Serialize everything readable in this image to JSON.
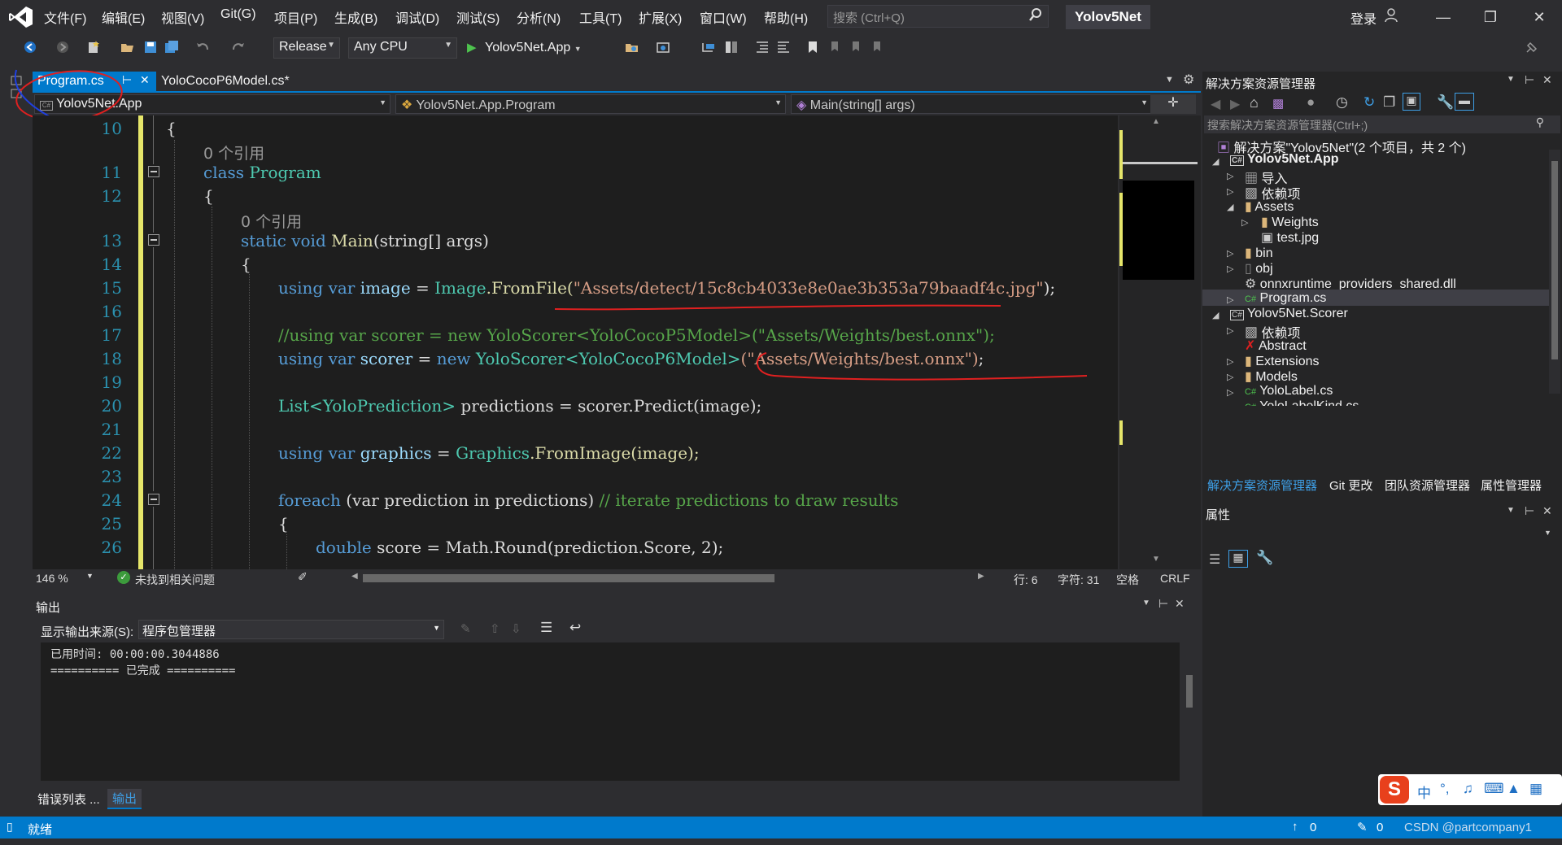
{
  "app": {
    "solution_name": "Yolov5Net",
    "menu": [
      "文件(F)",
      "编辑(E)",
      "视图(V)",
      "Git(G)",
      "项目(P)",
      "生成(B)",
      "调试(D)",
      "测试(S)",
      "分析(N)",
      "工具(T)",
      "扩展(X)",
      "窗口(W)",
      "帮助(H)"
    ],
    "search_placeholder": "搜索 (Ctrl+Q)",
    "sign_in": "登录",
    "colors": {
      "accent": "#007acc",
      "background": "#2d2d30",
      "editor": "#1e1e1e"
    }
  },
  "toolbar": {
    "configuration": "Release",
    "platform": "Any CPU",
    "start_project": "Yolov5Net.App"
  },
  "tabs": {
    "active": "Program.cs",
    "other": "YoloCocoP6Model.cs*"
  },
  "navbar": {
    "project": "Yolov5Net.App",
    "class": "Yolov5Net.App.Program",
    "member": "Main(string[] args)"
  },
  "editor": {
    "line_numbers": [
      "10",
      "11",
      "12",
      "13",
      "14",
      "15",
      "16",
      "17",
      "18",
      "19",
      "20",
      "21",
      "22",
      "23",
      "24",
      "25",
      "26"
    ],
    "ref_count_1": "0 个引用",
    "ref_count_2": "0 个引用",
    "lines": {
      "l10": "{",
      "l11_kw": "class",
      "l11_type": "Program",
      "l12": "{",
      "l13_kw": "static void",
      "l13_name": "Main",
      "l13_rest": "(string[] args)",
      "l14": "{",
      "l15_a": "using var",
      "l15_b": "image",
      "l15_c": " = ",
      "l15_type": "Image",
      "l15_m": ".FromFile(",
      "l15_str": "\"Assets/detect/15c8cb4033e8e0ae3b353a79baadf4c.jpg\"",
      "l15_end": ");",
      "l17": "//using var scorer = new YoloScorer<YoloCocoP5Model>(\"Assets/Weights/best.onnx\");",
      "l18_a": "using var",
      "l18_b": "scorer",
      "l18_c": " = ",
      "l18_new": "new",
      "l18_type": "YoloScorer<YoloCocoP6Model>",
      "l18_str": "(\"Assets/Weights/best.onnx\")",
      "l18_end": ";",
      "l20_type": "List<YoloPrediction>",
      "l20_rest": "predictions = scorer.Predict(image);",
      "l22_a": "using var",
      "l22_b": "graphics",
      "l22_c": " = ",
      "l22_type": "Graphics",
      "l22_rest": ".FromImage(image);",
      "l24_kw": "foreach",
      "l24_rest": " (var prediction in predictions)",
      "l24_cm": "// iterate predictions to draw results",
      "l25": "{",
      "l26_kw": "double",
      "l26_rest": " score = Math.Round(prediction.Score, 2);"
    }
  },
  "statusline": {
    "zoom": "146 %",
    "issues": "未找到相关问题",
    "line": "行: 6",
    "char": "字符: 31",
    "ws": "空格",
    "eol": "CRLF"
  },
  "output": {
    "title": "输出",
    "source_label": "显示输出来源(S):",
    "source_value": "程序包管理器",
    "line1": "已用时间: 00:00:00.3044886",
    "line2": "========== 已完成 =========="
  },
  "bottom_tabs": [
    "错误列表 ...",
    "输出"
  ],
  "status": {
    "ready": "就绪",
    "up_count": "0",
    "edit_count": "0",
    "watermark": "CSDN @partcompany1"
  },
  "solution_explorer": {
    "title": "解决方案资源管理器",
    "search_placeholder": "搜索解决方案资源管理器(Ctrl+;)",
    "items": [
      {
        "label": "解决方案\"Yolov5Net\"(2 个项目，共 2 个)",
        "bold": false
      },
      {
        "label": "Yolov5Net.App",
        "bold": true
      },
      {
        "label": "导入",
        "bold": false
      },
      {
        "label": "依赖项",
        "bold": false
      },
      {
        "label": "Assets",
        "bold": false
      },
      {
        "label": "Weights",
        "bold": false
      },
      {
        "label": "test.jpg",
        "bold": false
      },
      {
        "label": "bin",
        "bold": false
      },
      {
        "label": "obj",
        "bold": false
      },
      {
        "label": "onnxruntime_providers_shared.dll",
        "bold": false
      },
      {
        "label": "Program.cs",
        "bold": false
      },
      {
        "label": "Yolov5Net.Scorer",
        "bold": false
      },
      {
        "label": "依赖项",
        "bold": false
      },
      {
        "label": "Abstract",
        "bold": false
      },
      {
        "label": "Extensions",
        "bold": false
      },
      {
        "label": "Models",
        "bold": false
      },
      {
        "label": "YoloLabel.cs",
        "bold": false
      },
      {
        "label": "YoloLabelKind.cs",
        "bold": false
      }
    ],
    "tabs": [
      "解决方案资源管理器",
      "Git 更改",
      "团队资源管理器",
      "属性管理器"
    ]
  },
  "properties": {
    "title": "属性"
  },
  "ime": {
    "lang": "中"
  }
}
